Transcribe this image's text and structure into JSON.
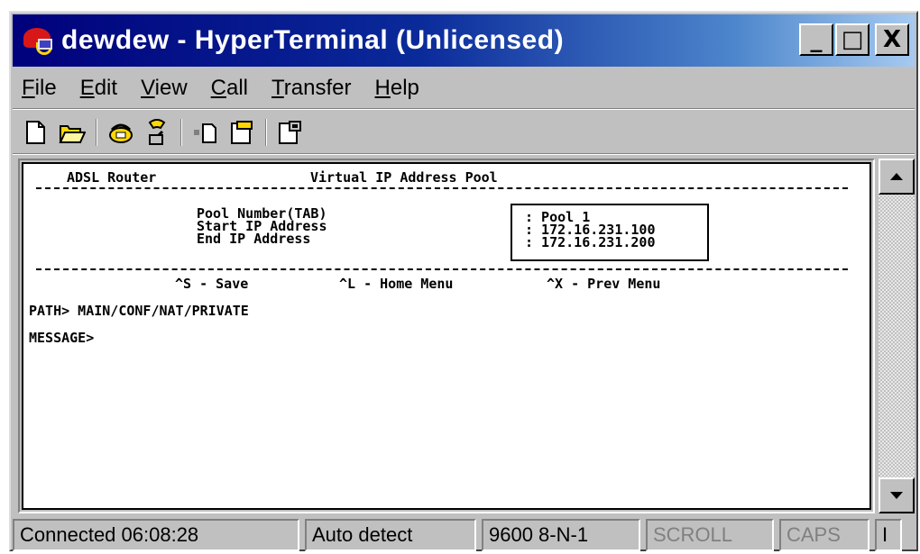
{
  "window": {
    "title": "dewdew - HyperTerminal (Unlicensed)",
    "minimize_glyph": "_",
    "maximize_glyph": "□",
    "close_glyph": "X"
  },
  "menubar": {
    "items": [
      {
        "first": "F",
        "rest": "ile"
      },
      {
        "first": "E",
        "rest": "dit"
      },
      {
        "first": "V",
        "rest": "iew"
      },
      {
        "first": "C",
        "rest": "all"
      },
      {
        "first": "T",
        "rest": "ransfer"
      },
      {
        "first": "H",
        "rest": "elp"
      }
    ]
  },
  "toolbar": {
    "icons": [
      "new-icon",
      "open-icon",
      "call-icon",
      "disconnect-icon",
      "send-icon",
      "receive-icon",
      "properties-icon"
    ]
  },
  "terminal": {
    "header_left": "ADSL Router",
    "header_center": "Virtual IP Address Pool",
    "fields": [
      {
        "label": "Pool Number(TAB)",
        "value": ": Pool 1"
      },
      {
        "label": "Start IP Address",
        "value": ": 172.16.231.100"
      },
      {
        "label": "End IP Address",
        "value": ": 172.16.231.200"
      }
    ],
    "shortcuts": [
      "^S - Save",
      "^L - Home Menu",
      "^X - Prev Menu"
    ],
    "path_line": "PATH> MAIN/CONF/NAT/PRIVATE",
    "message_line": "MESSAGE>"
  },
  "statusbar": {
    "connected": "Connected 06:08:28",
    "detect": "Auto detect",
    "settings": "9600 8-N-1",
    "scroll": "SCROLL",
    "caps": "CAPS",
    "num": "I"
  },
  "colors": {
    "title_gradient_start": "#00007b",
    "title_gradient_end": "#a6caf0",
    "chrome": "#c0c0c0"
  }
}
